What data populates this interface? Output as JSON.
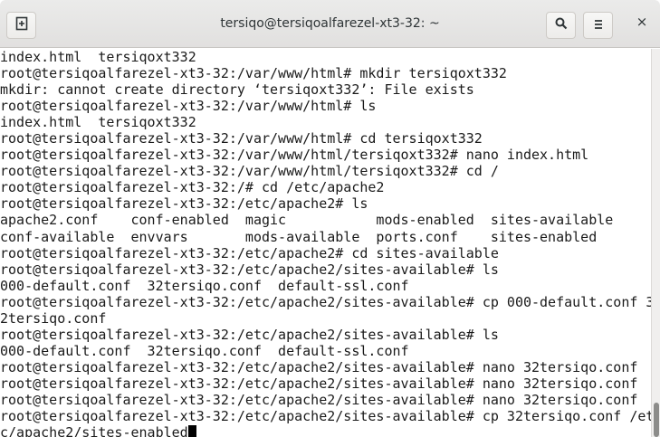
{
  "window": {
    "title": "tersiqo@tersiqoalfarezel-xt3-32: ~"
  },
  "icons": {
    "new_tab": "new-tab-icon",
    "search": "search-icon",
    "menu": "hamburger-menu-icon",
    "close": "close-icon"
  },
  "glyphs": {
    "new_tab": "⊞",
    "search": "🔍︎",
    "menu": "≡",
    "close": "×"
  },
  "scrollbar": {
    "position_percent": 100
  },
  "terminal": {
    "lines": [
      "index.html  tersiqoxt332",
      "root@tersiqoalfarezel-xt3-32:/var/www/html# mkdir tersiqoxt332",
      "mkdir: cannot create directory ‘tersiqoxt332’: File exists",
      "root@tersiqoalfarezel-xt3-32:/var/www/html# ls",
      "index.html  tersiqoxt332",
      "root@tersiqoalfarezel-xt3-32:/var/www/html# cd tersiqoxt332",
      "root@tersiqoalfarezel-xt3-32:/var/www/html/tersiqoxt332# nano index.html",
      "root@tersiqoalfarezel-xt3-32:/var/www/html/tersiqoxt332# cd /",
      "root@tersiqoalfarezel-xt3-32:/# cd /etc/apache2",
      "root@tersiqoalfarezel-xt3-32:/etc/apache2# ls",
      "apache2.conf    conf-enabled  magic           mods-enabled  sites-available",
      "conf-available  envvars       mods-available  ports.conf    sites-enabled",
      "root@tersiqoalfarezel-xt3-32:/etc/apache2# cd sites-available",
      "root@tersiqoalfarezel-xt3-32:/etc/apache2/sites-available# ls",
      "000-default.conf  32tersiqo.conf  default-ssl.conf",
      "root@tersiqoalfarezel-xt3-32:/etc/apache2/sites-available# cp 000-default.conf 3",
      "2tersiqo.conf",
      "root@tersiqoalfarezel-xt3-32:/etc/apache2/sites-available# ls",
      "000-default.conf  32tersiqo.conf  default-ssl.conf",
      "root@tersiqoalfarezel-xt3-32:/etc/apache2/sites-available# nano 32tersiqo.conf",
      "root@tersiqoalfarezel-xt3-32:/etc/apache2/sites-available# nano 32tersiqo.conf",
      "root@tersiqoalfarezel-xt3-32:/etc/apache2/sites-available# nano 32tersiqo.conf",
      "root@tersiqoalfarezel-xt3-32:/etc/apache2/sites-available# cp 32tersiqo.conf /et",
      "c/apache2/sites-enabled"
    ]
  }
}
